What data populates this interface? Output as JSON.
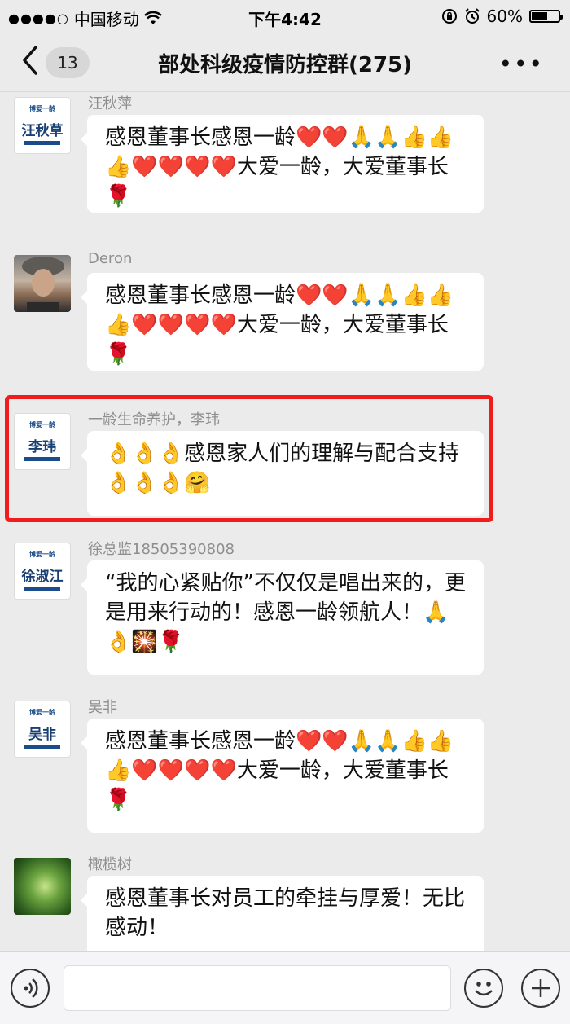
{
  "status": {
    "carrier": "中国移动",
    "time": "下午4:42",
    "battery": "60%",
    "battery_level": 0.6
  },
  "nav": {
    "unread": "13",
    "title": "部处科级疫情防控群(275)",
    "more": "•••"
  },
  "messages": [
    {
      "sender": "汪秋萍",
      "avatar_text": "汪秋草",
      "avatar_brand": "博爱一龄",
      "text": "感恩董事长感恩一龄❤️❤️🙏🙏👍👍👍❤️❤️❤️❤️大爱一龄，大爱董事长🌹"
    },
    {
      "sender": "Deron",
      "text": "感恩董事长感恩一龄❤️❤️🙏🙏👍👍👍❤️❤️❤️❤️大爱一龄，大爱董事长🌹"
    },
    {
      "sender": "一龄生命养护，李玮",
      "avatar_text": "李玮",
      "avatar_brand": "博爱一龄",
      "text": "👌👌👌感恩家人们的理解与配合支持👌👌👌🤗"
    },
    {
      "sender": "徐总监18505390808",
      "avatar_text": "徐淑江",
      "avatar_brand": "博爱一龄",
      "text": "“我的心紧贴你”不仅仅是唱出来的，更是用来行动的！感恩一龄领航人！🙏👌🎇🌹"
    },
    {
      "sender": "吴非",
      "avatar_text": "吴非",
      "avatar_brand": "博爱一龄",
      "text": "感恩董事长感恩一龄❤️❤️🙏🙏👍👍👍❤️❤️❤️❤️大爱一龄，大爱董事长🌹"
    },
    {
      "sender": "橄榄树",
      "text": "感恩董事长对员工的牵挂与厚爱！无比感动！"
    }
  ]
}
